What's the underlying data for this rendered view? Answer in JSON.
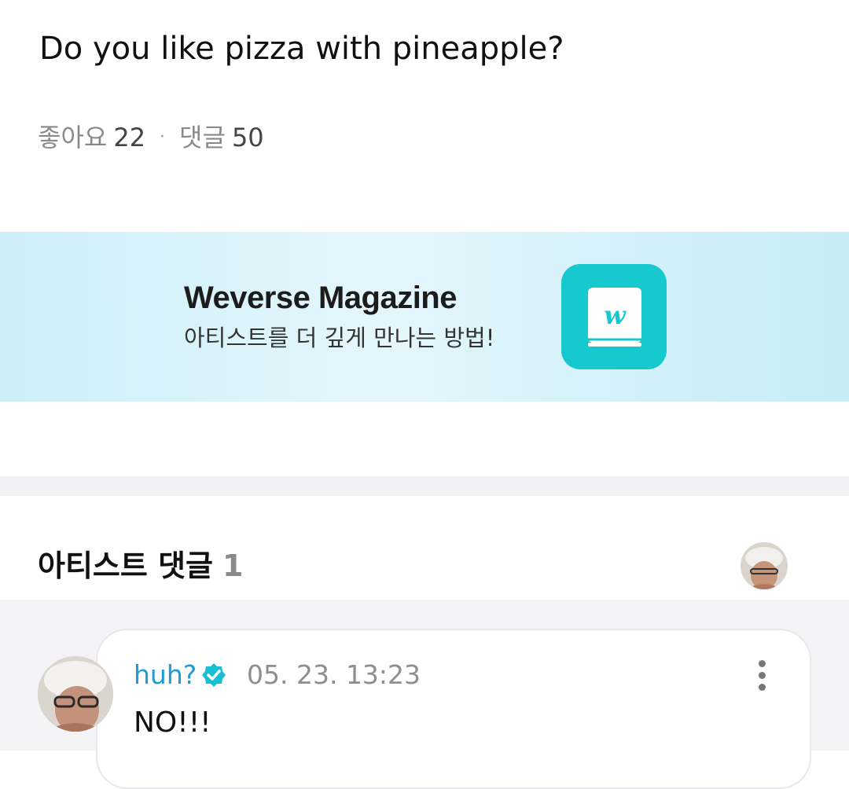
{
  "post": {
    "text": "Do you like pizza with pineapple?",
    "likes_label": "좋아요",
    "likes_count": "22",
    "separator": "·",
    "comments_label": "댓글",
    "comments_count": "50"
  },
  "banner": {
    "title": "Weverse Magazine",
    "subtitle": "아티스트를 더 깊게 만나는 방법!",
    "icon": "weverse-magazine-book-icon",
    "icon_letter": "w",
    "background_color": "#cdeff8",
    "icon_color": "#16c9cf"
  },
  "artist_comments": {
    "title": "아티스트 댓글",
    "count": "1"
  },
  "comment": {
    "author": "huh?",
    "time": "05. 23. 13:23",
    "text": "NO!!!",
    "author_color": "#1d9bd6",
    "badge_icon": "verified-badge-icon"
  }
}
